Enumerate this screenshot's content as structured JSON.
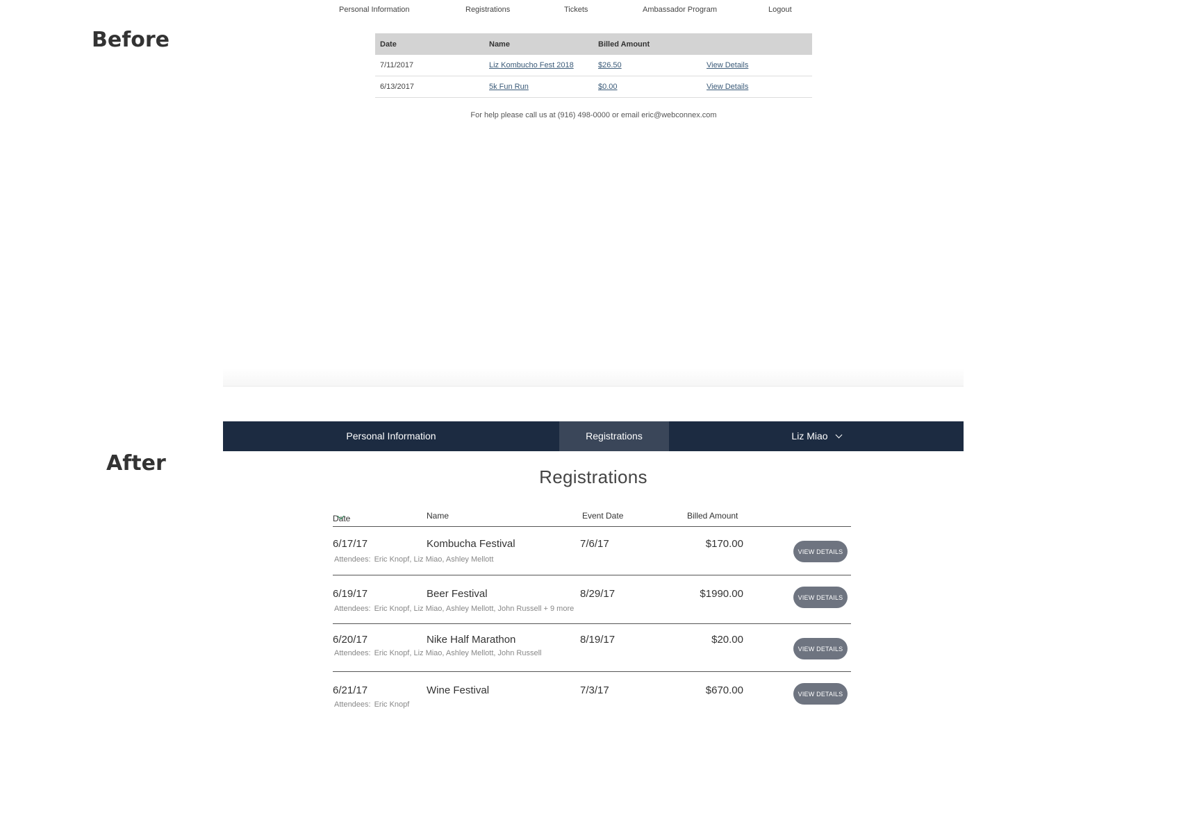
{
  "labels": {
    "before": "Before",
    "after": "After"
  },
  "before": {
    "nav": [
      "Personal Information",
      "Registrations",
      "Tickets",
      "Ambassador Program",
      "Logout"
    ],
    "table": {
      "headers": [
        "Date",
        "Name",
        "Billed Amount"
      ],
      "rows": [
        {
          "date": "7/11/2017",
          "name": "Liz Kombucho Fest 2018",
          "amount": "$26.50",
          "action": "View Details"
        },
        {
          "date": "6/13/2017",
          "name": "5k Fun Run",
          "amount": "$0.00",
          "action": "View Details"
        }
      ]
    },
    "help": "For help please call us at (916) 498-0000 or email eric@webconnex.com"
  },
  "after": {
    "nav": {
      "personal": "Personal Information",
      "registrations": "Registrations",
      "user": "Liz Miao"
    },
    "title": "Registrations",
    "table": {
      "headers": {
        "date": "Date",
        "name": "Name",
        "event_date": "Event Date",
        "amount": "Billed Amount"
      },
      "attendees_label": "Attendees:",
      "button_label": "VIEW DETAILS",
      "rows": [
        {
          "date": "6/17/17",
          "name": "Kombucha Festival",
          "event_date": "7/6/17",
          "amount": "$170.00",
          "attendees": "Eric Knopf, Liz Miao, Ashley Mellott"
        },
        {
          "date": "6/19/17",
          "name": "Beer Festival",
          "event_date": "8/29/17",
          "amount": "$1990.00",
          "attendees": "Eric Knopf, Liz Miao, Ashley Mellott, John Russell + 9 more"
        },
        {
          "date": "6/20/17",
          "name": "Nike Half Marathon",
          "event_date": "8/19/17",
          "amount": "$20.00",
          "attendees": "Eric Knopf, Liz Miao, Ashley Mellott, John Russell"
        },
        {
          "date": "6/21/17",
          "name": "Wine Festival",
          "event_date": "7/3/17",
          "amount": "$670.00",
          "attendees": "Eric Knopf"
        }
      ]
    }
  },
  "colors": {
    "nav_bg": "#1c2b41",
    "nav_active": "#3a4659",
    "button_bg": "#6e7480",
    "sort_accent": "#2e8b57"
  }
}
